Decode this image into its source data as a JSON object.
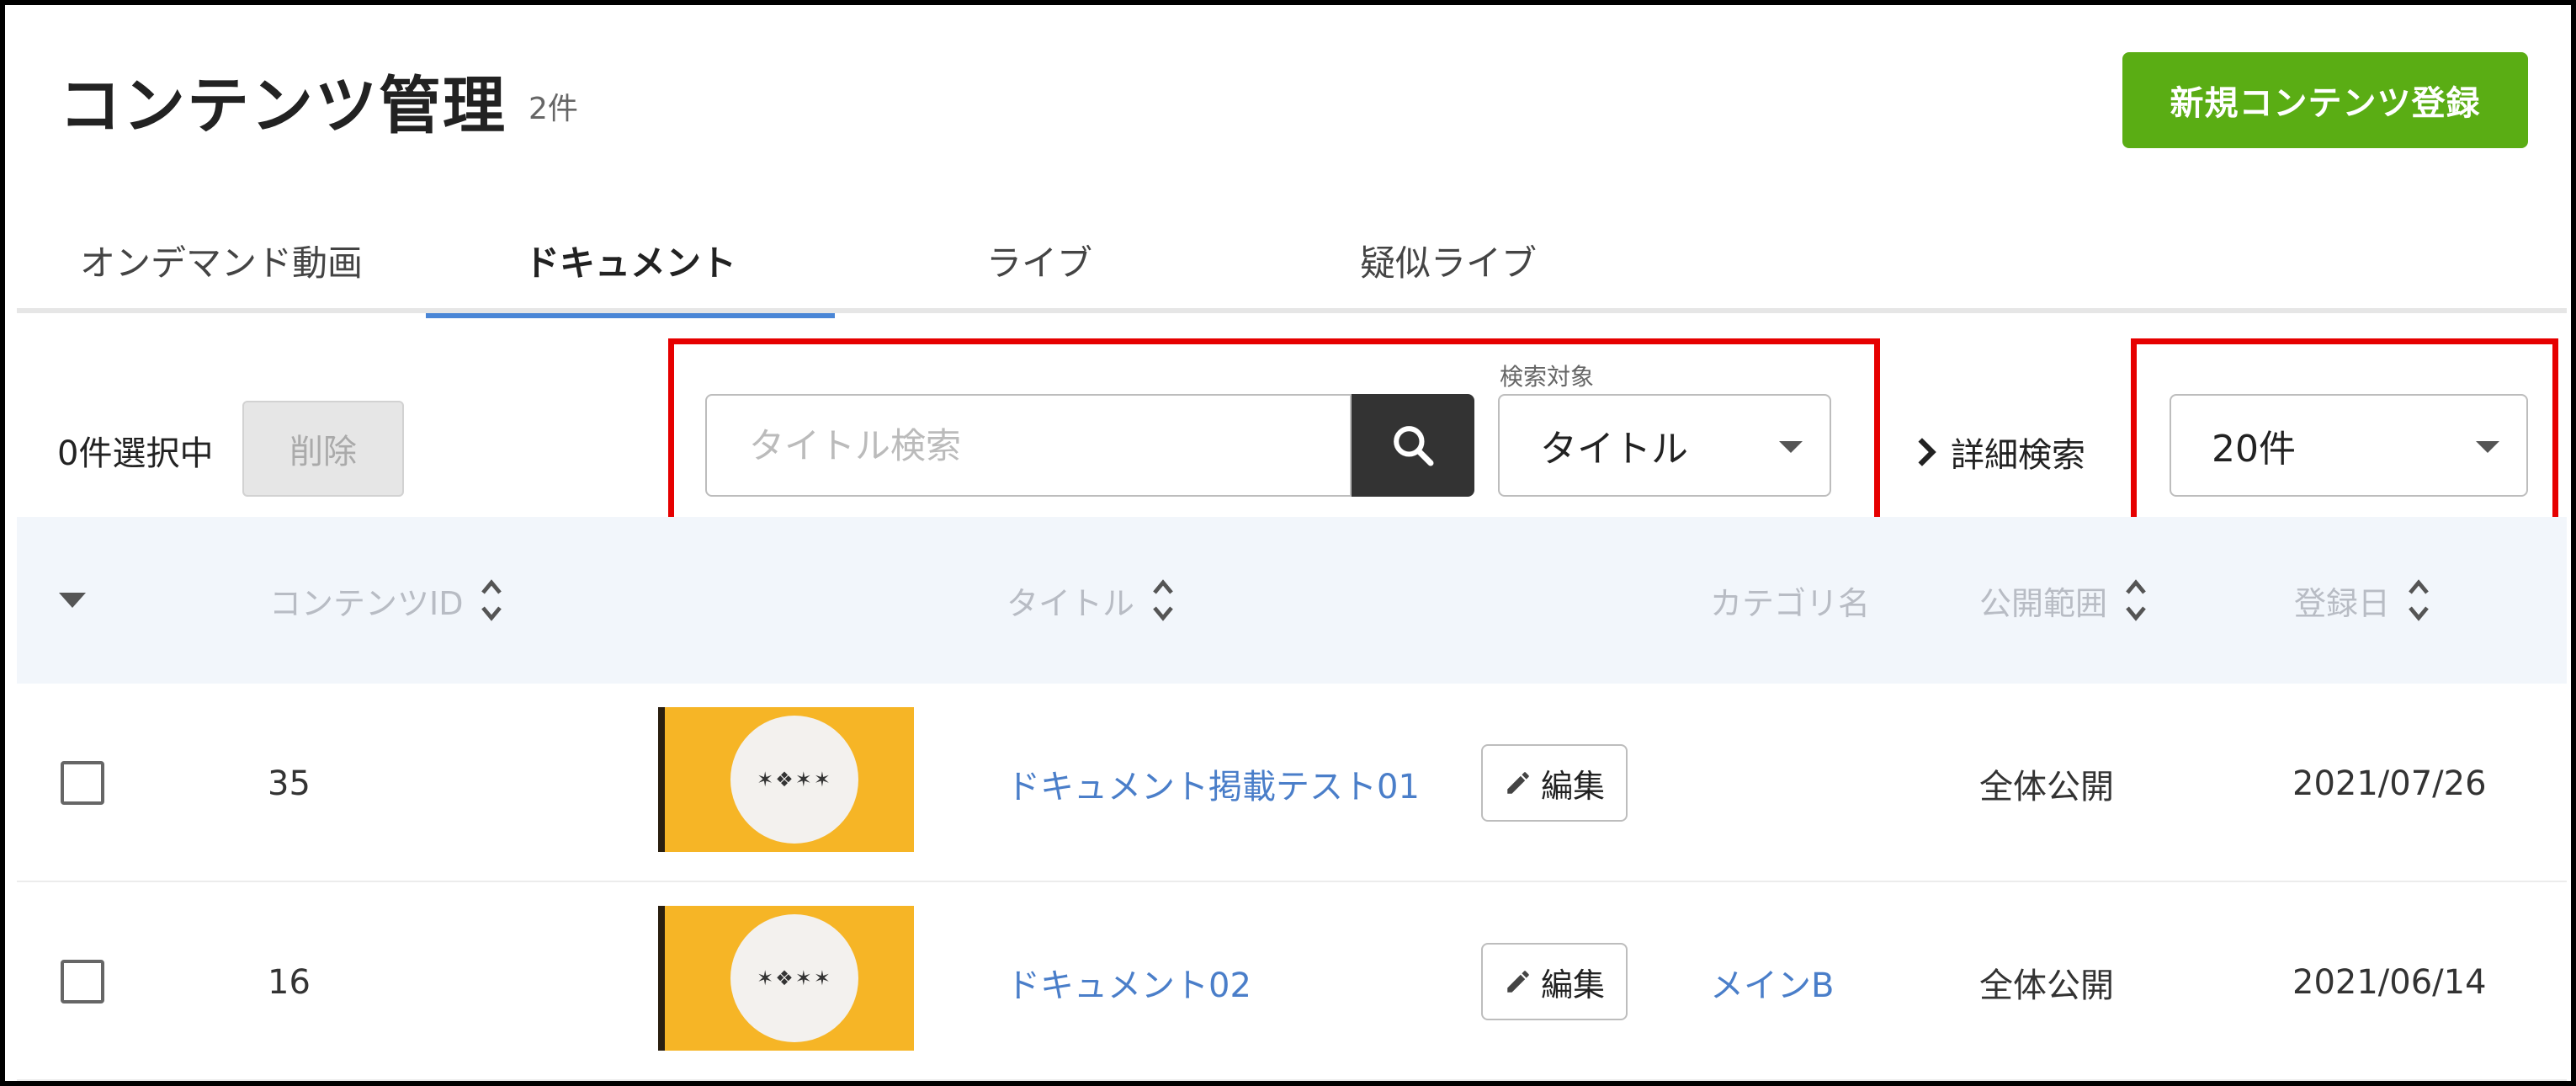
{
  "header": {
    "title": "コンテンツ管理",
    "count": "2件",
    "new_button": "新規コンテンツ登録"
  },
  "tabs": [
    {
      "label": "オンデマンド動画",
      "active": false
    },
    {
      "label": "ドキュメント",
      "active": true
    },
    {
      "label": "ライブ",
      "active": false
    },
    {
      "label": "疑似ライブ",
      "active": false
    }
  ],
  "toolbar": {
    "selected_count": "0件選択中",
    "delete_label": "削除",
    "search_placeholder": "タイトル検索",
    "search_target_label": "検索対象",
    "search_target_value": "タイトル",
    "advanced_search": "詳細検索",
    "per_page": "20件"
  },
  "table": {
    "columns": {
      "content_id": "コンテンツID",
      "title": "タイトル",
      "category": "カテゴリ名",
      "visibility": "公開範囲",
      "registered": "登録日"
    },
    "edit_label": "編集",
    "thumb_mark": "✶❖✶✶",
    "rows": [
      {
        "id": "35",
        "title": "ドキュメント掲載テスト01",
        "category": "",
        "visibility": "全体公開",
        "date": "2021/07/26"
      },
      {
        "id": "16",
        "title": "ドキュメント02",
        "category": "メインB",
        "visibility": "全体公開",
        "date": "2021/06/14"
      }
    ]
  },
  "colors": {
    "primary_green": "#5aad14",
    "tab_active_underline": "#4a86d6",
    "link_blue": "#4a7ec9",
    "highlight_red": "#e60000",
    "thumbnail_orange": "#f6b526"
  }
}
